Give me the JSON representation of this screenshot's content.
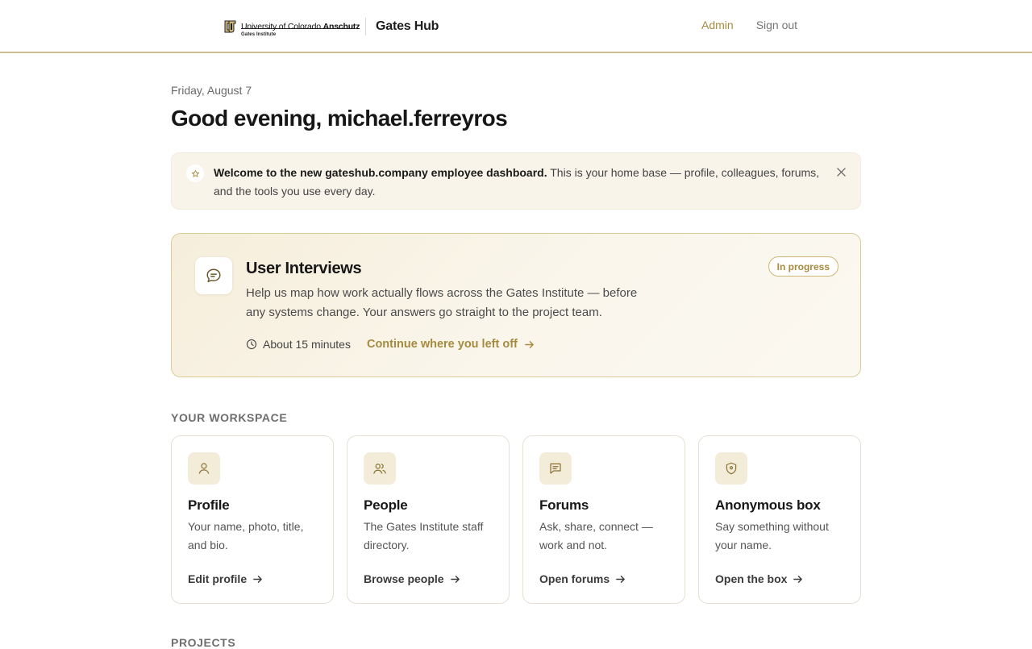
{
  "header": {
    "logo": {
      "university": "University of Colorado",
      "campus": "Anschutz",
      "unit": "Gates Institute"
    },
    "app_title": "Gates Hub",
    "nav": {
      "admin": "Admin",
      "sign_out": "Sign out"
    }
  },
  "main": {
    "date": "Friday, August 7",
    "greeting": "Good evening, michael.ferreyros",
    "notice": {
      "bold": "Welcome to the new gateshub.company employee dashboard.",
      "text": " This is your home base — profile, colleagues, forums, and the tools you use every day.",
      "icon": "star-icon"
    },
    "interview": {
      "title": "User Interviews",
      "description": "Help us map how work actually flows across the Gates Institute — before any systems change. Your answers go straight to the project team.",
      "duration": "About 15 minutes",
      "cta": "Continue where you left off",
      "badge": "In progress",
      "icon": "chat-bubble-icon"
    },
    "workspace": {
      "label": "YOUR WORKSPACE",
      "cards": [
        {
          "title": "Profile",
          "description": "Your name, photo, title, and bio.",
          "link": "Edit profile",
          "icon": "user-icon"
        },
        {
          "title": "People",
          "description": "The Gates Institute staff directory.",
          "link": "Browse people",
          "icon": "users-icon"
        },
        {
          "title": "Forums",
          "description": "Ask, share, connect — work and not.",
          "link": "Open forums",
          "icon": "message-square-icon"
        },
        {
          "title": "Anonymous box",
          "description": "Say something without your name.",
          "link": "Open the box",
          "icon": "shield-icon"
        }
      ]
    },
    "projects": {
      "label": "PROJECTS"
    }
  },
  "colors": {
    "accent": "#a68a3e",
    "accent_border": "#dccb97",
    "notice_bg": "#f8f4e9",
    "icon_tile_bg": "#f3ecd9"
  }
}
